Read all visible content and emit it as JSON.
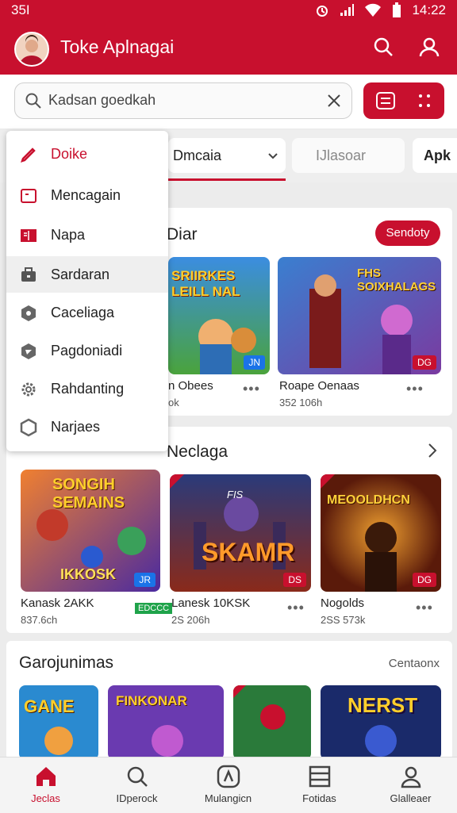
{
  "status": {
    "left": "35I",
    "time": "14:22"
  },
  "app": {
    "title": "Toke Aplnagai"
  },
  "search": {
    "placeholder": "Kadsan goedkah"
  },
  "tabs": [
    {
      "label": "Dmcaia"
    },
    {
      "label": "IJlasoar"
    },
    {
      "label": "Apk"
    }
  ],
  "dropdown": {
    "items": [
      {
        "label": "Doike",
        "icon": "pencil-icon"
      },
      {
        "label": "Mencagain",
        "icon": "folder-icon"
      },
      {
        "label": "Napa",
        "icon": "book-icon"
      },
      {
        "label": "Sardaran",
        "icon": "briefcase-icon"
      },
      {
        "label": "Caceliaga",
        "icon": "cube-icon"
      },
      {
        "label": "Pagdoniadi",
        "icon": "shield-icon"
      },
      {
        "label": "Rahdanting",
        "icon": "gear-icon"
      },
      {
        "label": "Narjaes",
        "icon": "puzzle-icon"
      }
    ]
  },
  "section1": {
    "title": "Diar",
    "action": "Sendoty",
    "games": [
      {
        "art": "SRIIRKES LEILL NAL",
        "name": "n Obees",
        "sub": "ok",
        "badge": "JN"
      },
      {
        "art": "FHS SOIXHALAGS",
        "name": "Roape Oenaas",
        "sub": "352 106h",
        "badge": "DG"
      }
    ]
  },
  "section2": {
    "title": "Neclaga",
    "games": [
      {
        "art": "SONGIH SEMAINS",
        "art2": "IKKOSK",
        "name": "Kanask 2AKK",
        "sub": "837.6ch",
        "badge": "JR",
        "extra": "EDCCC"
      },
      {
        "art": "SKAMR",
        "art2": "FIS",
        "name": "Lanesk 10KSK",
        "sub": "2S 206h",
        "badge": "DS"
      },
      {
        "art": "MEOOLDHCN",
        "name": "Nogolds",
        "sub": "2SS 573k",
        "badge": "DG"
      }
    ]
  },
  "section3": {
    "title": "Garojunimas",
    "action": "Centaonx",
    "tiles": [
      {
        "art": "GANE"
      },
      {
        "art": "FINKONAR"
      },
      {
        "art": ""
      },
      {
        "art": "NERST"
      }
    ]
  },
  "bottomnav": [
    {
      "label": "Jeclas",
      "icon": "home-icon"
    },
    {
      "label": "IDperock",
      "icon": "search-icon"
    },
    {
      "label": "Mulangicn",
      "icon": "compass-icon"
    },
    {
      "label": "Fotidas",
      "icon": "list-icon"
    },
    {
      "label": "Glalleaer",
      "icon": "profile-icon"
    }
  ],
  "colors": {
    "brand": "#c8102e",
    "badge_blue": "#1a73e8",
    "badge_green": "#1fa34a"
  }
}
